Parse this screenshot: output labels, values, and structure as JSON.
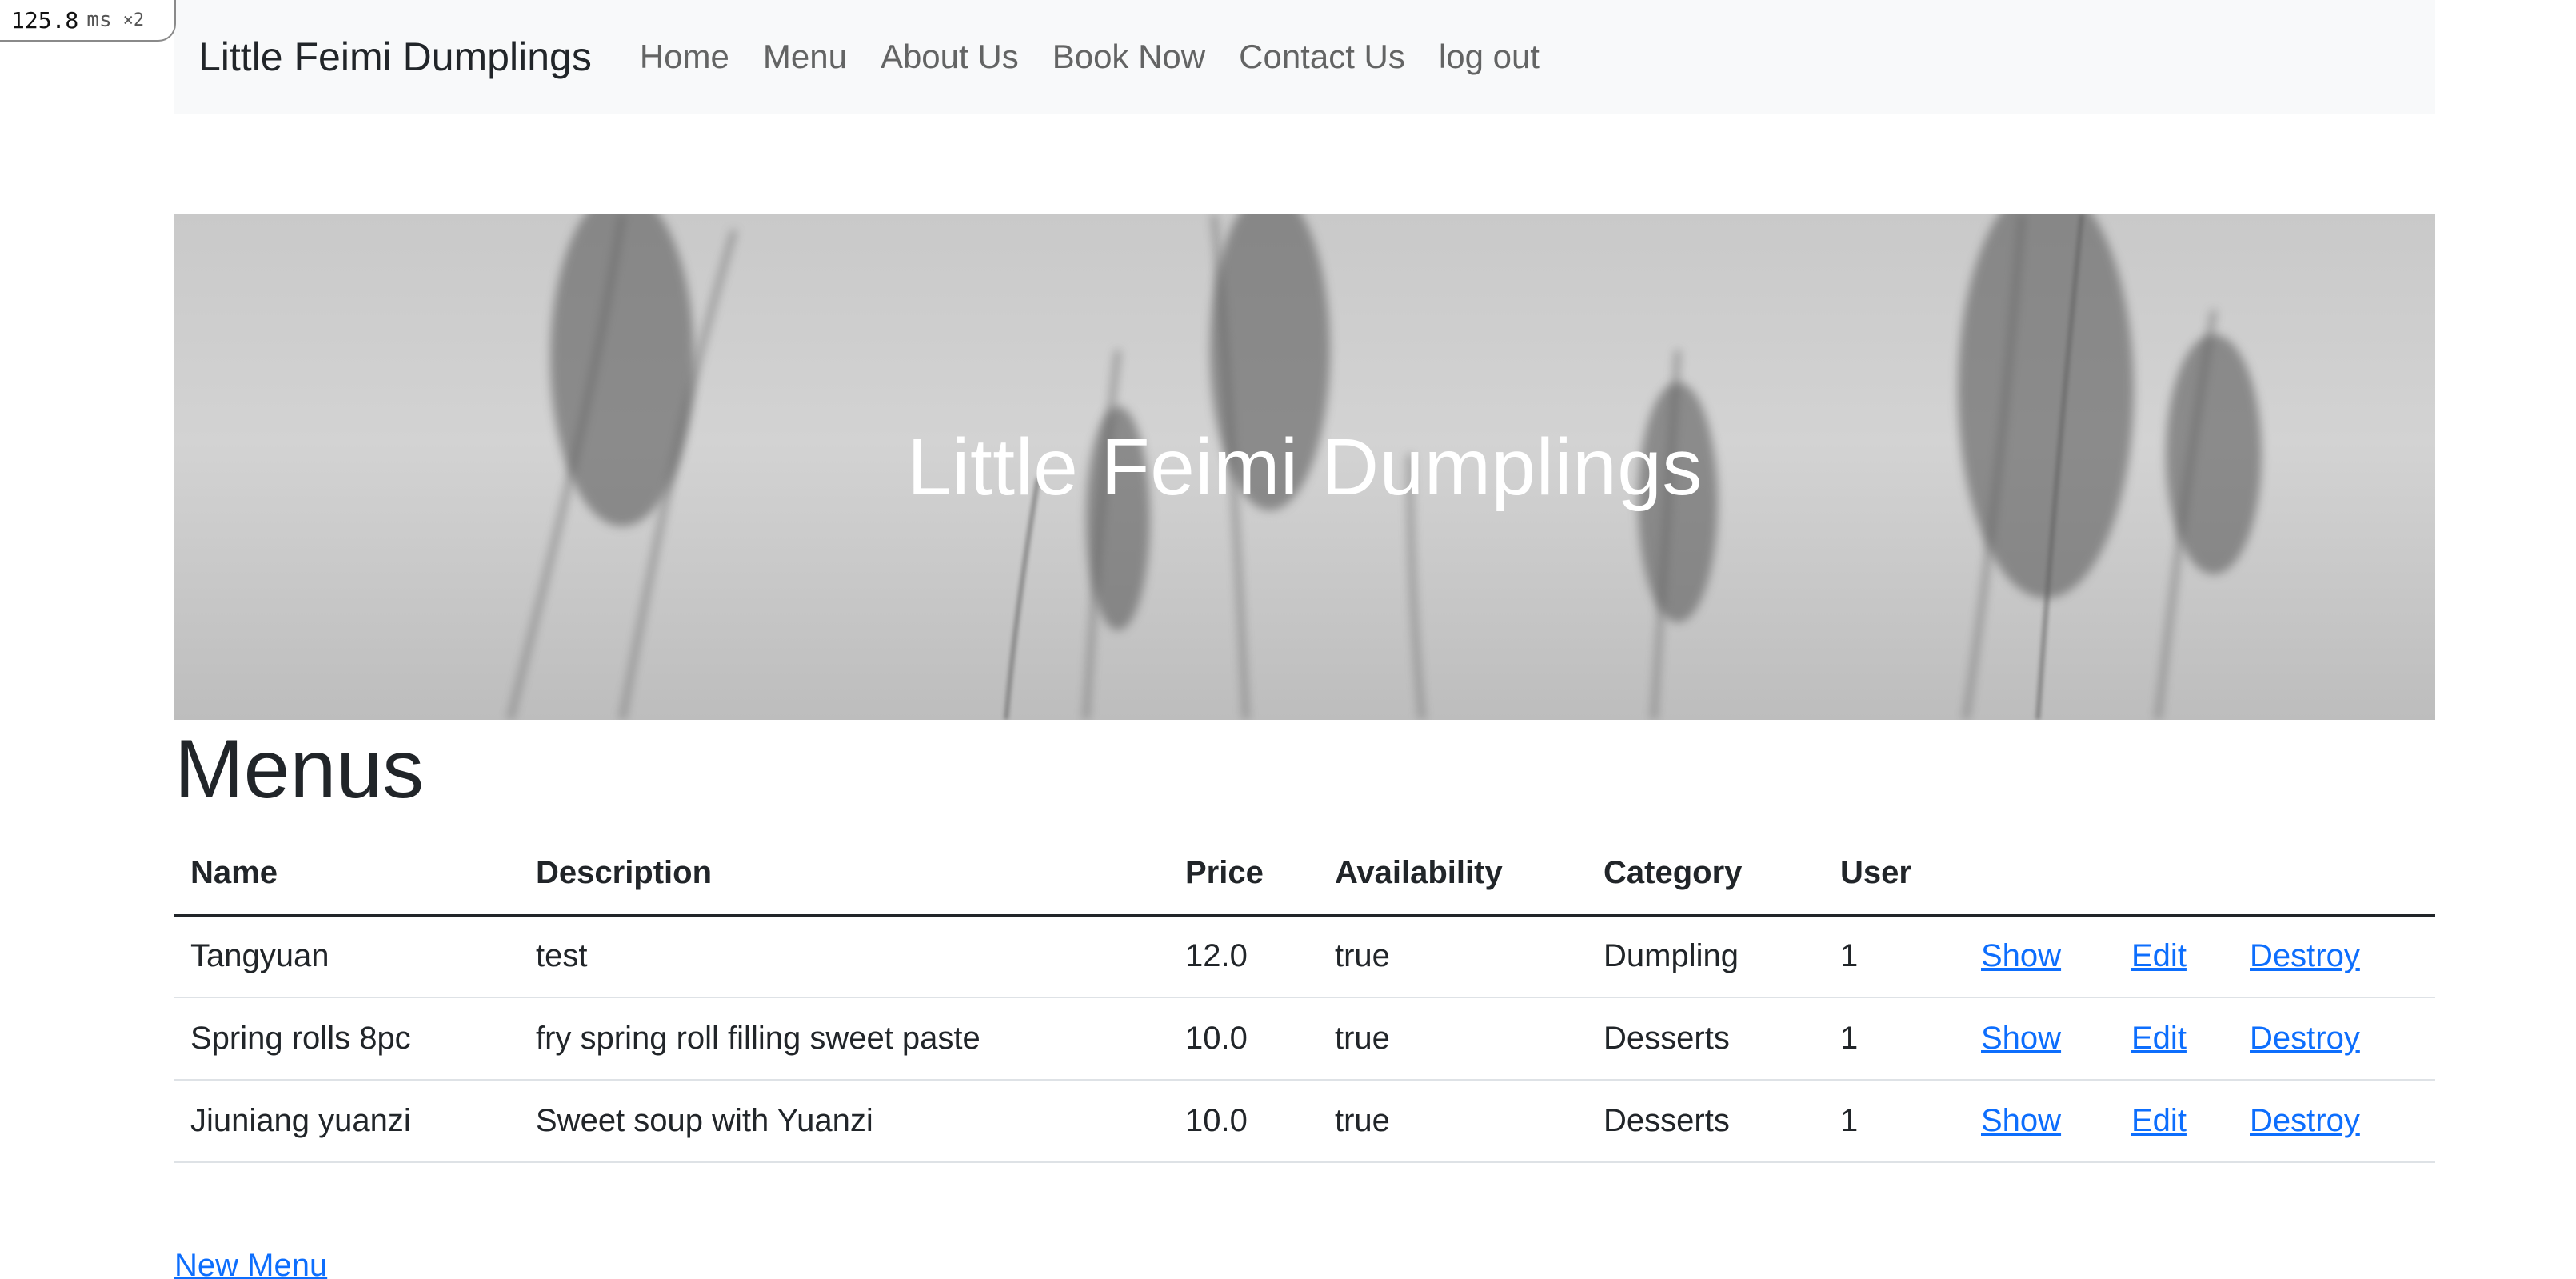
{
  "perf": {
    "value": "125.8",
    "unit": "ms",
    "multiplier": "×2"
  },
  "navbar": {
    "brand": "Little Feimi Dumplings",
    "links": [
      "Home",
      "Menu",
      "About Us",
      "Book Now",
      "Contact Us",
      "log out"
    ]
  },
  "hero": {
    "title": "Little Feimi Dumplings"
  },
  "page": {
    "heading": "Menus",
    "new_link": "New Menu"
  },
  "table": {
    "headers": [
      "Name",
      "Description",
      "Price",
      "Availability",
      "Category",
      "User",
      "",
      "",
      ""
    ],
    "rows": [
      {
        "name": "Tangyuan",
        "description": "test",
        "price": "12.0",
        "availability": "true",
        "category": "Dumpling",
        "user": "1"
      },
      {
        "name": "Spring rolls 8pc",
        "description": "fry spring roll filling sweet paste",
        "price": "10.0",
        "availability": "true",
        "category": "Desserts",
        "user": "1"
      },
      {
        "name": "Jiuniang yuanzi",
        "description": "Sweet soup with Yuanzi",
        "price": "10.0",
        "availability": "true",
        "category": "Desserts",
        "user": "1"
      }
    ],
    "actions": {
      "show": "Show",
      "edit": "Edit",
      "destroy": "Destroy"
    }
  },
  "colors": {
    "link": "#0d6efd",
    "navbar_bg": "#f8f9fa",
    "text": "#212529"
  }
}
